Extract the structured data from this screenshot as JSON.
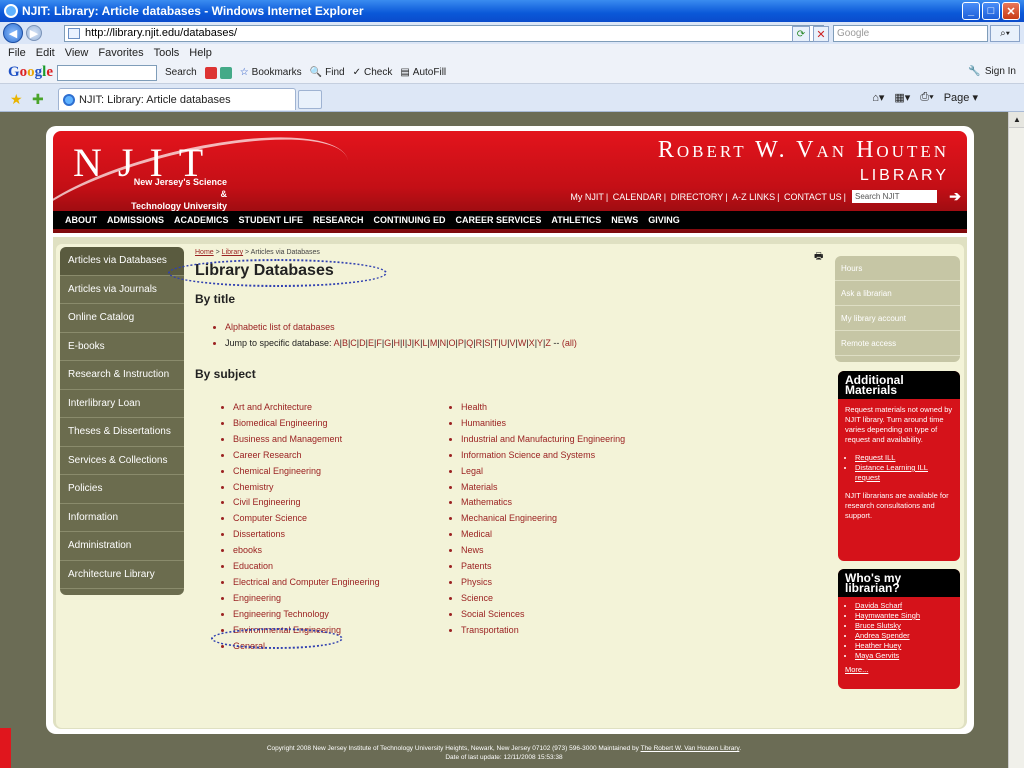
{
  "window": {
    "title": "NJIT: Library: Article databases - Windows Internet Explorer"
  },
  "browser": {
    "url": "http://library.njit.edu/databases/",
    "search_placeholder": "Google",
    "menu": [
      "File",
      "Edit",
      "View",
      "Favorites",
      "Tools",
      "Help"
    ],
    "google_toolbar": {
      "search_label": "Search",
      "bookmarks": "Bookmarks",
      "find": "Find",
      "check": "Check",
      "autofill": "AutoFill",
      "signin": "Sign In"
    },
    "tab_title": "NJIT: Library: Article databases",
    "page_menu": "Page"
  },
  "header": {
    "logo": "NJIT",
    "logo_sub1": "New Jersey's Science &",
    "logo_sub2": "Technology University",
    "library_name1": "Robert W. Van Houten",
    "library_name2": "LIBRARY",
    "util_links": [
      "My NJIT",
      "CALENDAR",
      "DIRECTORY",
      "A-Z LINKS",
      "CONTACT US"
    ],
    "search_placeholder": "Search NJIT",
    "nav": [
      "ABOUT",
      "ADMISSIONS",
      "ACADEMICS",
      "STUDENT LIFE",
      "RESEARCH",
      "CONTINUING ED",
      "CAREER SERVICES",
      "ATHLETICS",
      "NEWS",
      "GIVING"
    ]
  },
  "leftnav": [
    "Articles via Databases",
    "Articles via Journals",
    "Online Catalog",
    "E-books",
    "Research & Instruction",
    "Interlibrary Loan",
    "Theses & Dissertations",
    "Services & Collections",
    "Policies",
    "Information",
    "Administration",
    "Architecture Library"
  ],
  "main": {
    "breadcrumb": {
      "home": "Home",
      "library": "Library",
      "current": "Articles via Databases"
    },
    "title": "Library Databases",
    "by_title": "By title",
    "alpha_list": "Alphabetic list of databases",
    "jump_label": "Jump to specific database:",
    "letters": [
      "A",
      "B",
      "C",
      "D",
      "E",
      "F",
      "G",
      "H",
      "I",
      "J",
      "K",
      "L",
      "M",
      "N",
      "O",
      "P",
      "Q",
      "R",
      "S",
      "T",
      "U",
      "V",
      "W",
      "X",
      "Y",
      "Z"
    ],
    "all_label": "(all)",
    "by_subject": "By subject",
    "subjects_col1": [
      "Art and Architecture",
      "Biomedical Engineering",
      "Business and Management",
      "Career Research",
      "Chemical Engineering",
      "Chemistry",
      "Civil Engineering",
      "Computer Science",
      "Dissertations",
      "ebooks",
      "Education",
      "Electrical and Computer Engineering",
      "Engineering",
      "Engineering Technology",
      "Environmental Engineering",
      "General"
    ],
    "subjects_col2": [
      "Health",
      "Humanities",
      "Industrial and Manufacturing Engineering",
      "Information Science and Systems",
      "Legal",
      "Materials",
      "Mathematics",
      "Mechanical Engineering",
      "Medical",
      "News",
      "Patents",
      "Physics",
      "Science",
      "Social Sciences",
      "Transportation"
    ]
  },
  "rightnav": [
    "Hours",
    "Ask a librarian",
    "My library account",
    "Remote access"
  ],
  "additional": {
    "title": "Additional Materials",
    "text": "Request materials not owned by NJIT library. Turn around time varies depending on type of request and availability.",
    "links": [
      "Request ILL",
      "Distance Learning ILL request"
    ],
    "text2": "NJIT librarians are available for research consultations and support."
  },
  "librarian": {
    "title": "Who's my librarian?",
    "names": [
      "Davida Scharf",
      "Haymwantee Singh",
      "Bruce Slutsky",
      "Andrea Spender",
      "Heather Huey",
      "Maya Gervits"
    ],
    "more": "More..."
  },
  "footer": {
    "line1": "Copyright 2008 New Jersey Institute of Technology    University Heights, Newark, New Jersey 07102    (973) 596-3000 Maintained by",
    "link": "The Robert W. Van Houten Library",
    "line2": "Date of last update: 12/11/2008 15:53:38"
  }
}
